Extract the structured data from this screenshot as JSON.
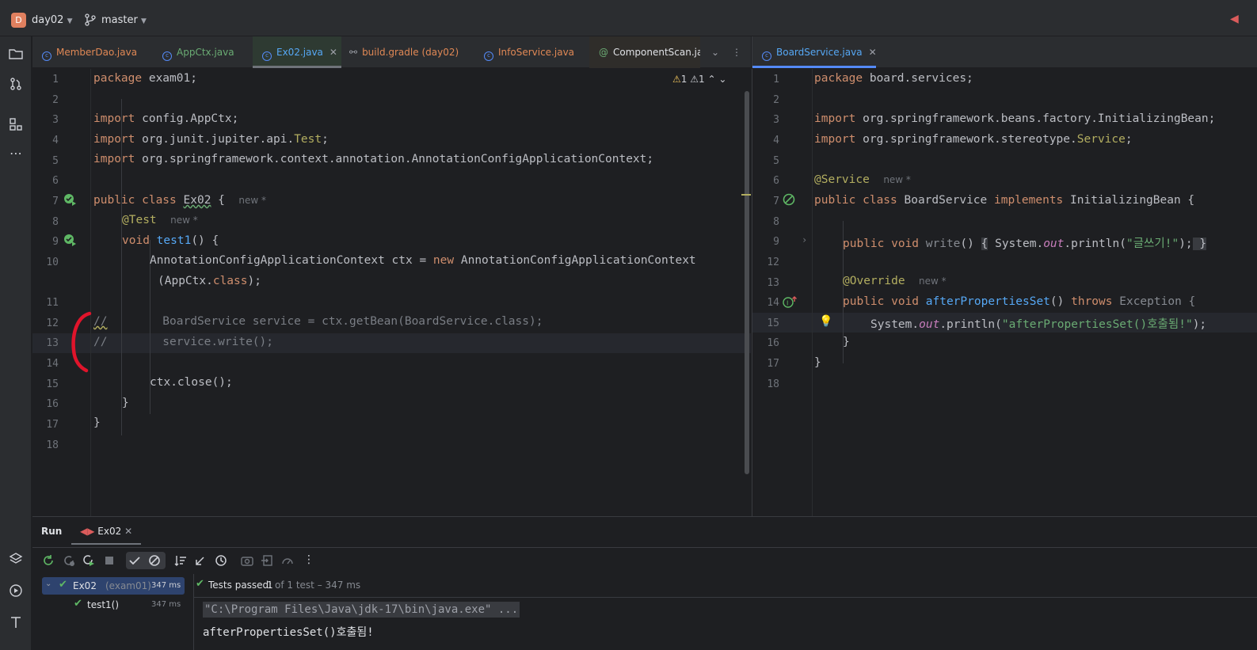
{
  "titlebar": {
    "project_initial": "D",
    "project": "day02",
    "branch": "master"
  },
  "left_tabs": [
    {
      "label": "MemberDao.java",
      "color": "#e08855"
    },
    {
      "label": "AppCtx.java",
      "color": "#6aab73"
    },
    {
      "label": "Ex02.java",
      "color": "#56a8f5"
    },
    {
      "label": "build.gradle (day02)",
      "color": "#e08855"
    },
    {
      "label": "InfoService.java",
      "color": "#e08855"
    },
    {
      "label": "ComponentScan.java",
      "color": "#dfe1e5"
    }
  ],
  "right_tabs": [
    {
      "label": "BoardService.java",
      "color": "#56a8f5"
    }
  ],
  "warnings": {
    "a": "1",
    "b": "1"
  },
  "left_editor": {
    "hint_new": "new *",
    "line_numbers": [
      "1",
      "2",
      "3",
      "4",
      "5",
      "6",
      "7",
      "8",
      "9",
      "10",
      "",
      "11",
      "12",
      "13",
      "14",
      "15",
      "16",
      "17",
      "18"
    ],
    "l1": [
      "package",
      " exam01;"
    ],
    "l3": [
      "import",
      " config.AppCtx;"
    ],
    "l4": [
      "import",
      " org.junit.jupiter.api.",
      "Test",
      ";"
    ],
    "l5": [
      "import",
      " org.springframework.context.annotation.AnnotationConfigApplicationContext;"
    ],
    "l7": [
      "public class",
      " ",
      "Ex02",
      " {"
    ],
    "l8": "@Test",
    "l9": [
      "void",
      " ",
      "test1",
      "() {"
    ],
    "l10": [
      "AnnotationConfigApplicationContext ctx = ",
      "new",
      " AnnotationConfigApplicationContext"
    ],
    "l10b": [
      "(AppCtx.",
      "class",
      ");"
    ],
    "l12": [
      "//",
      "        BoardService service = ctx.getBean(BoardService.class);"
    ],
    "l13": [
      "//",
      "        service.write();"
    ],
    "l15": "ctx.close();",
    "l16": "}",
    "l17": "}"
  },
  "right_editor": {
    "hint_new": "new *",
    "line_numbers": [
      "1",
      "2",
      "3",
      "4",
      "5",
      "6",
      "7",
      "8",
      "9",
      "12",
      "13",
      "14",
      "15",
      "16",
      "17",
      "18"
    ],
    "r1": [
      "package",
      " board.services;"
    ],
    "r3": [
      "import",
      " org.springframework.beans.factory.InitializingBean;"
    ],
    "r4": [
      "import",
      " org.springframework.stereotype.",
      "Service",
      ";"
    ],
    "r6": "@Service",
    "r7": [
      "public class",
      " BoardService ",
      "implements",
      " InitializingBean {"
    ],
    "r9": [
      "public void",
      " ",
      "write",
      "() ",
      "{",
      " System.",
      "out",
      ".println(",
      "\"글쓰기!\"",
      ");",
      " }"
    ],
    "r13": "@Override",
    "r14": [
      "public void",
      " ",
      "afterPropertiesSet",
      "() ",
      "throws",
      " Exception {"
    ],
    "r15": [
      "System.",
      "out",
      ".println(",
      "\"afterPropertiesSet()호출됨!\"",
      ");"
    ],
    "r16": "}",
    "r17": "}"
  },
  "run_panel": {
    "title": "Run",
    "tab": "Ex02",
    "tree": [
      {
        "label": "Ex02",
        "sub": "(exam01)",
        "time": "347 ms"
      },
      {
        "label": "test1()",
        "time": "347 ms"
      }
    ],
    "status_prefix": "Tests passed:",
    "status_count": "1",
    "status_suffix": "of 1 test – 347 ms",
    "output": [
      "\"C:\\Program Files\\Java\\jdk-17\\bin\\java.exe\" ...",
      "afterPropertiesSet()호출됨!"
    ]
  }
}
